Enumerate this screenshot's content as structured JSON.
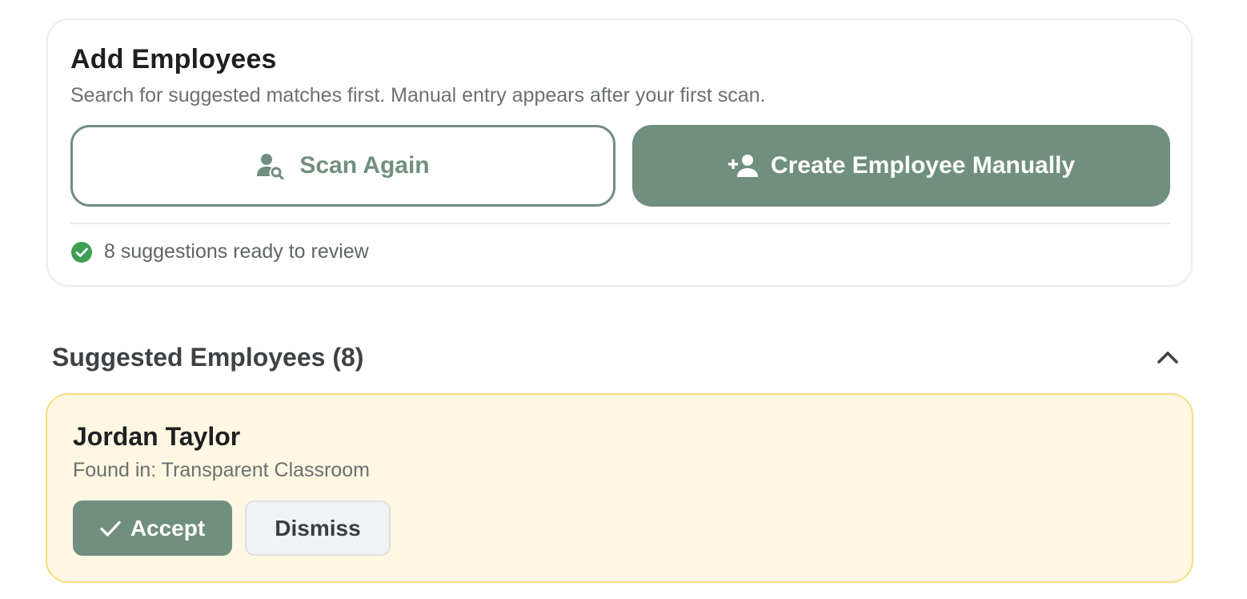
{
  "add_employees": {
    "title": "Add Employees",
    "subtitle": "Search for suggested matches first. Manual entry appears after your first scan.",
    "scan_button": {
      "label": "Scan Again",
      "icon": "person-search-icon"
    },
    "create_button": {
      "label": "Create Employee Manually",
      "icon": "person-add-icon"
    },
    "status": {
      "text": "8 suggestions ready to review",
      "icon": "check-circle-icon"
    }
  },
  "suggested": {
    "title": "Suggested Employees (8)",
    "toggle_icon": "chevron-up-icon",
    "items": [
      {
        "name": "Jordan Taylor",
        "source": "Found in: Transparent Classroom",
        "accept_label": "Accept",
        "dismiss_label": "Dismiss"
      }
    ]
  },
  "colors": {
    "accent": "#718f7e",
    "success": "#3e9f55",
    "suggestion_bg": "#fef7e1",
    "suggestion_border": "#f6dd86"
  }
}
